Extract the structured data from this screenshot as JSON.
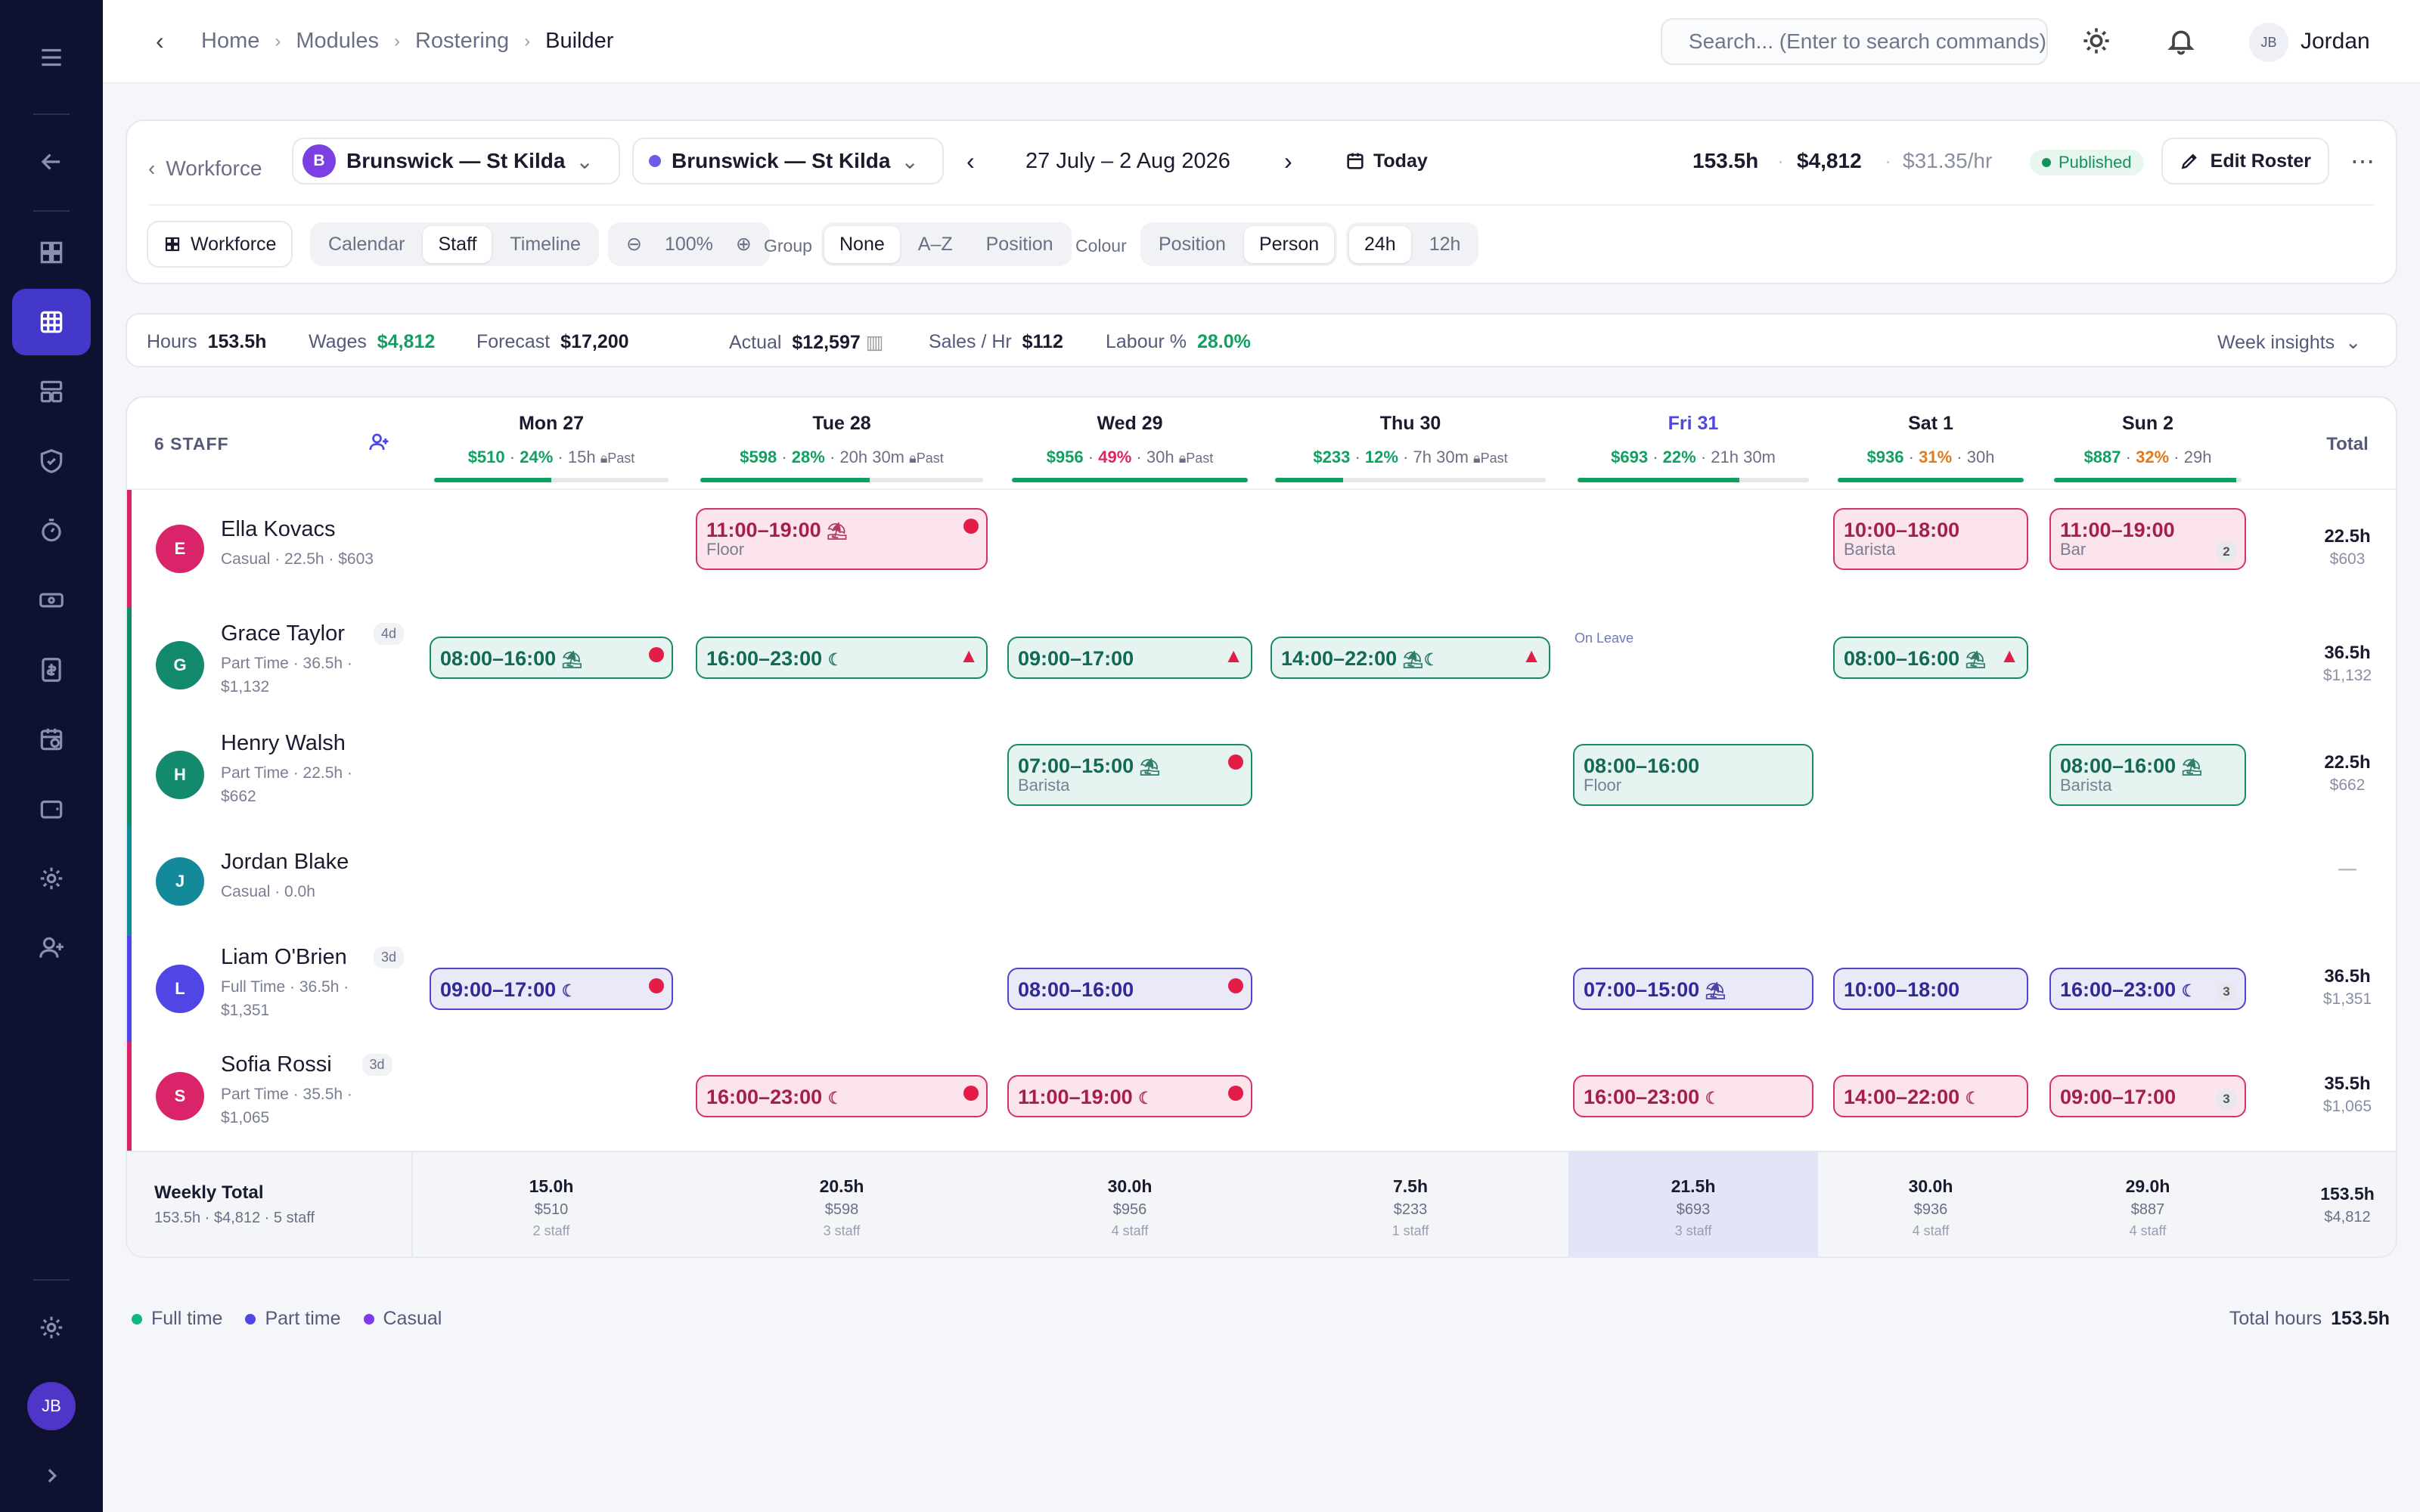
{
  "breadcrumb": [
    "Home",
    "Modules",
    "Rostering",
    "Builder"
  ],
  "search": {
    "placeholder": "Search... (Enter to search commands)"
  },
  "user": {
    "initials": "JB",
    "name": "Jordan"
  },
  "rail": {
    "avatar_initials": "JB"
  },
  "controls": {
    "back_label": "Workforce",
    "location1": {
      "initial": "B",
      "name": "Brunswick — St Kilda"
    },
    "location2": {
      "name": "Brunswick — St Kilda"
    },
    "date_range": "27 July – 2 Aug 2026",
    "today_label": "Today",
    "hours": "153.5h",
    "wages": "$4,812",
    "rate": "$31.35/hr",
    "status": "Published",
    "edit_label": "Edit Roster",
    "workforce_btn": "Workforce",
    "views": [
      "Calendar",
      "Staff",
      "Timeline"
    ],
    "zoom": "100%",
    "group_label": "Group",
    "group_opts": [
      "None",
      "A–Z",
      "Position"
    ],
    "colour_label": "Colour",
    "colour_opts": [
      "Position",
      "Person"
    ],
    "time_opts": [
      "24h",
      "12h"
    ]
  },
  "stats": {
    "hours_label": "Hours",
    "hours": "153.5h",
    "wages_label": "Wages",
    "wages": "$4,812",
    "forecast_label": "Forecast",
    "forecast": "$17,200",
    "actual_label": "Actual",
    "actual": "$12,597",
    "sales_label": "Sales / Hr",
    "sales": "$112",
    "labour_label": "Labour %",
    "labour": "28.0%",
    "insights_label": "Week insights"
  },
  "grid": {
    "staff_count": "6 STAFF",
    "total_label": "Total",
    "days": [
      {
        "name": "Mon 27",
        "wages": "$510",
        "pct": "24%",
        "hours": "15h",
        "past": "Past",
        "fill": 0.5
      },
      {
        "name": "Tue 28",
        "wages": "$598",
        "pct": "28%",
        "hours": "20h 30m",
        "past": "Past",
        "fill": 0.6
      },
      {
        "name": "Wed 29",
        "wages": "$956",
        "pct": "49%",
        "hours": "30h",
        "past": "Past",
        "fill": 1.0
      },
      {
        "name": "Thu 30",
        "wages": "$233",
        "pct": "12%",
        "hours": "7h 30m",
        "past": "Past",
        "fill": 0.25
      },
      {
        "name": "Fri 31",
        "wages": "$693",
        "pct": "22%",
        "hours": "21h 30m",
        "past": "",
        "fill": 0.7
      },
      {
        "name": "Sat 1",
        "wages": "$936",
        "pct": "31%",
        "hours": "30h",
        "past": "",
        "fill": 1.0
      },
      {
        "name": "Sun 2",
        "wages": "$887",
        "pct": "32%",
        "hours": "29h",
        "past": "",
        "fill": 0.97
      }
    ],
    "staff": [
      {
        "initial": "E",
        "name": "Ella Kovacs",
        "tag": "",
        "meta1": "Casual · 22.5h · $603",
        "meta2": "",
        "total_h": "22.5h",
        "total_w": "$603",
        "color": "#d9246a"
      },
      {
        "initial": "G",
        "name": "Grace Taylor",
        "tag": "4d",
        "meta1": "Part Time · 36.5h ·",
        "meta2": "$1,132",
        "total_h": "36.5h",
        "total_w": "$1,132",
        "color": "#138a6e",
        "on_leave": "On Leave"
      },
      {
        "initial": "H",
        "name": "Henry Walsh",
        "tag": "",
        "meta1": "Part Time · 22.5h ·",
        "meta2": "$662",
        "total_h": "22.5h",
        "total_w": "$662",
        "color": "#138a6e"
      },
      {
        "initial": "J",
        "name": "Jordan Blake",
        "tag": "",
        "meta1": "Casual · 0.0h",
        "meta2": "",
        "total_h": "—",
        "total_w": "",
        "color": "#138a9a"
      },
      {
        "initial": "L",
        "name": "Liam O'Brien",
        "tag": "3d",
        "meta1": "Full Time · 36.5h ·",
        "meta2": "$1,351",
        "total_h": "36.5h",
        "total_w": "$1,351",
        "color": "#4f46e5"
      },
      {
        "initial": "S",
        "name": "Sofia Rossi",
        "tag": "3d",
        "meta1": "Part Time · 35.5h ·",
        "meta2": "$1,065",
        "total_h": "35.5h",
        "total_w": "$1,065",
        "color": "#d9246a"
      }
    ],
    "shifts": [
      {
        "row": 0,
        "day": 1,
        "time": "11:00–19:00",
        "pos": "Floor",
        "c": "p",
        "icon": "⛱",
        "dot": true
      },
      {
        "row": 0,
        "day": 5,
        "time": "10:00–18:00",
        "pos": "Barista",
        "c": "p"
      },
      {
        "row": 0,
        "day": 6,
        "time": "11:00–19:00",
        "pos": "Bar",
        "c": "p",
        "count": "2"
      },
      {
        "row": 1,
        "day": 0,
        "time": "08:00–16:00",
        "c": "g",
        "icon": "⛱",
        "dot": true
      },
      {
        "row": 1,
        "day": 1,
        "time": "16:00–23:00",
        "c": "g",
        "icon": "☾",
        "warn": true
      },
      {
        "row": 1,
        "day": 2,
        "time": "09:00–17:00",
        "c": "g",
        "warn": true
      },
      {
        "row": 1,
        "day": 3,
        "time": "14:00–22:00",
        "c": "g",
        "icon": "⛱☾",
        "warn": true
      },
      {
        "row": 1,
        "day": 5,
        "time": "08:00–16:00",
        "c": "g",
        "icon": "⛱",
        "warn": true
      },
      {
        "row": 2,
        "day": 2,
        "time": "07:00–15:00",
        "pos": "Barista",
        "c": "g",
        "icon": "⛱",
        "dot": true
      },
      {
        "row": 2,
        "day": 4,
        "time": "08:00–16:00",
        "pos": "Floor",
        "c": "g"
      },
      {
        "row": 2,
        "day": 6,
        "time": "08:00–16:00",
        "pos": "Barista",
        "c": "g",
        "icon": "⛱"
      },
      {
        "row": 4,
        "day": 0,
        "time": "09:00–17:00",
        "c": "i",
        "icon": "☾",
        "dot": true
      },
      {
        "row": 4,
        "day": 2,
        "time": "08:00–16:00",
        "c": "i",
        "dot": true
      },
      {
        "row": 4,
        "day": 4,
        "time": "07:00–15:00",
        "c": "i",
        "icon": "⛱"
      },
      {
        "row": 4,
        "day": 5,
        "time": "10:00–18:00",
        "c": "i"
      },
      {
        "row": 4,
        "day": 6,
        "time": "16:00–23:00",
        "c": "i",
        "icon": "☾",
        "count": "3"
      },
      {
        "row": 5,
        "day": 1,
        "time": "16:00–23:00",
        "c": "p",
        "icon": "☾",
        "dot": true
      },
      {
        "row": 5,
        "day": 2,
        "time": "11:00–19:00",
        "c": "p",
        "icon": "☾",
        "dot": true
      },
      {
        "row": 5,
        "day": 4,
        "time": "16:00–23:00",
        "c": "p",
        "icon": "☾"
      },
      {
        "row": 5,
        "day": 5,
        "time": "14:00–22:00",
        "c": "p",
        "icon": "☾"
      },
      {
        "row": 5,
        "day": 6,
        "time": "09:00–17:00",
        "c": "p",
        "count": "3"
      }
    ],
    "footer": {
      "label": "Weekly Total",
      "sub": "153.5h · $4,812 · 5 staff",
      "days": [
        {
          "h": "15.0h",
          "w": "$510",
          "s": "2 staff"
        },
        {
          "h": "20.5h",
          "w": "$598",
          "s": "3 staff"
        },
        {
          "h": "30.0h",
          "w": "$956",
          "s": "4 staff"
        },
        {
          "h": "7.5h",
          "w": "$233",
          "s": "1 staff"
        },
        {
          "h": "21.5h",
          "w": "$693",
          "s": "3 staff"
        },
        {
          "h": "30.0h",
          "w": "$936",
          "s": "4 staff"
        },
        {
          "h": "29.0h",
          "w": "$887",
          "s": "4 staff"
        }
      ],
      "total_h": "153.5h",
      "total_w": "$4,812"
    }
  },
  "legend": [
    "Full time",
    "Part time",
    "Casual"
  ],
  "legend_colors": [
    "#10b981",
    "#4f46e5",
    "#7c3aed"
  ],
  "total_hours_label": "Total hours",
  "total_hours": "153.5h",
  "colors": {
    "accent": "#4338ca",
    "green": "#10a060",
    "rail": "#0e1130"
  }
}
